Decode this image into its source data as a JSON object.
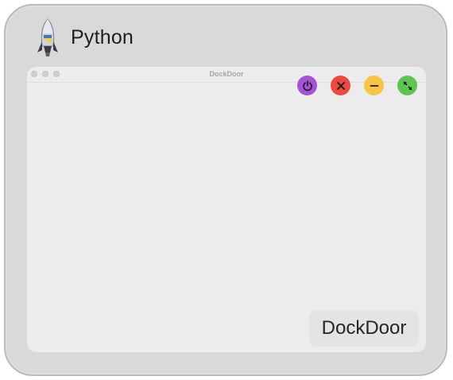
{
  "app": {
    "name": "Python",
    "icon": "python-rocket-icon"
  },
  "window": {
    "title": "DockDoor"
  },
  "controls": [
    {
      "icon": "power-icon",
      "color": "#a452d6"
    },
    {
      "icon": "close-icon",
      "color": "#ec4a3f"
    },
    {
      "icon": "minimize-icon",
      "color": "#f7c443"
    },
    {
      "icon": "fullscreen-icon",
      "color": "#5dc552"
    }
  ],
  "footer": {
    "label": "DockDoor"
  }
}
